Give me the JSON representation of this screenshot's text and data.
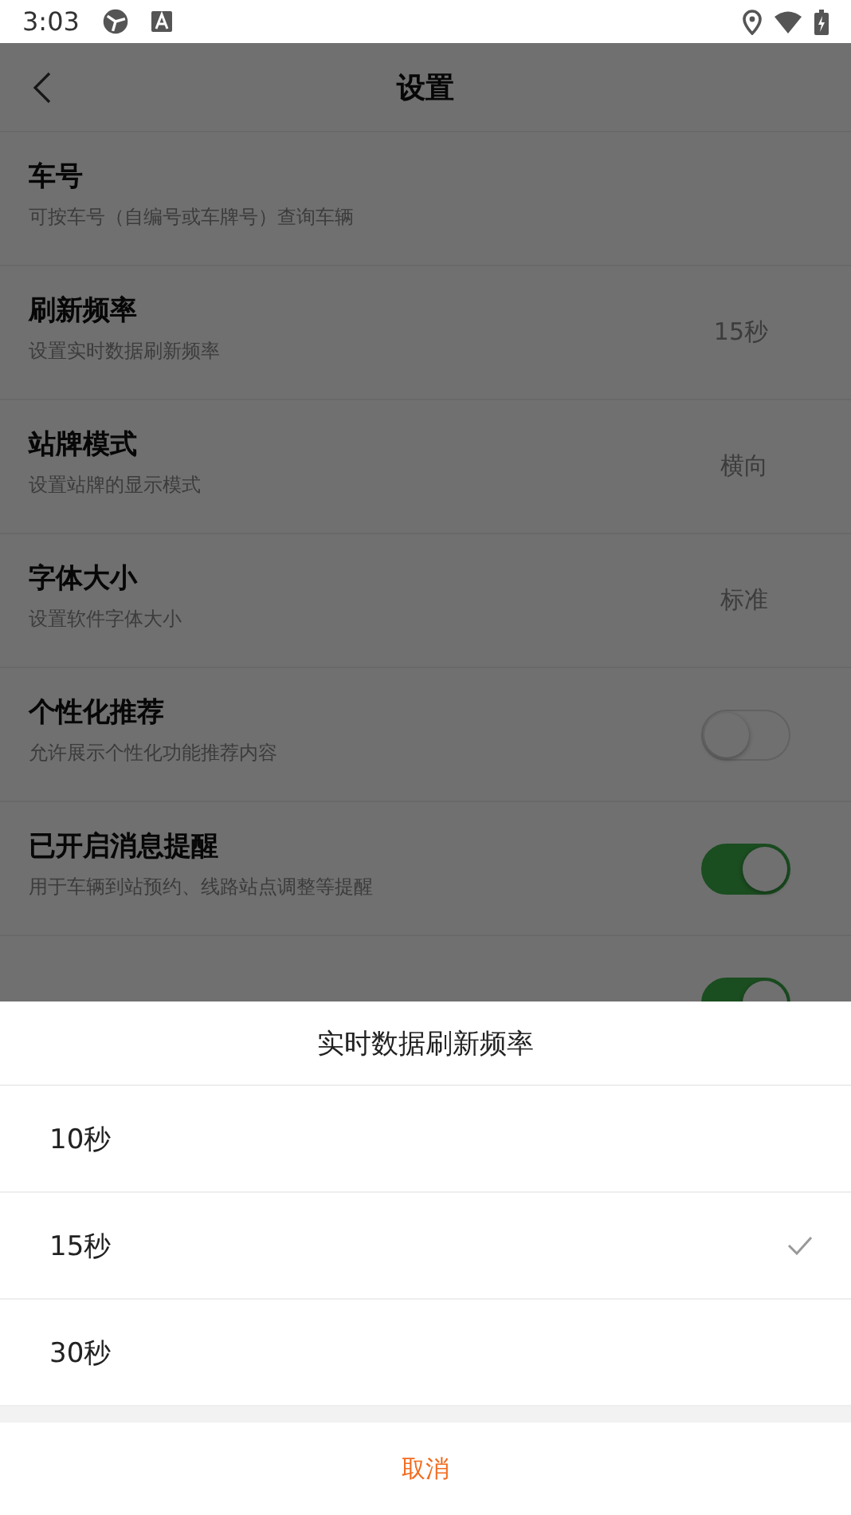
{
  "status_bar": {
    "time": "3:03"
  },
  "header": {
    "title": "设置"
  },
  "settings": [
    {
      "kind": "info",
      "title": "车号",
      "subtitle": "可按车号（自编号或车牌号）查询车辆"
    },
    {
      "kind": "value",
      "title": "刷新频率",
      "subtitle": "设置实时数据刷新频率",
      "value": "15秒"
    },
    {
      "kind": "value",
      "title": "站牌模式",
      "subtitle": "设置站牌的显示模式",
      "value": "横向"
    },
    {
      "kind": "value",
      "title": "字体大小",
      "subtitle": "设置软件字体大小",
      "value": "标准"
    },
    {
      "kind": "toggle",
      "title": "个性化推荐",
      "subtitle": "允许展示个性化功能推荐内容",
      "on": false
    },
    {
      "kind": "toggle",
      "title": "已开启消息提醒",
      "subtitle": "用于车辆到站预约、线路站点调整等提醒",
      "on": true
    },
    {
      "kind": "toggle",
      "on": true
    }
  ],
  "sheet": {
    "title": "实时数据刷新频率",
    "options": [
      {
        "label": "10秒",
        "selected": false
      },
      {
        "label": "15秒",
        "selected": true
      },
      {
        "label": "30秒",
        "selected": false
      }
    ],
    "cancel": "取消"
  }
}
